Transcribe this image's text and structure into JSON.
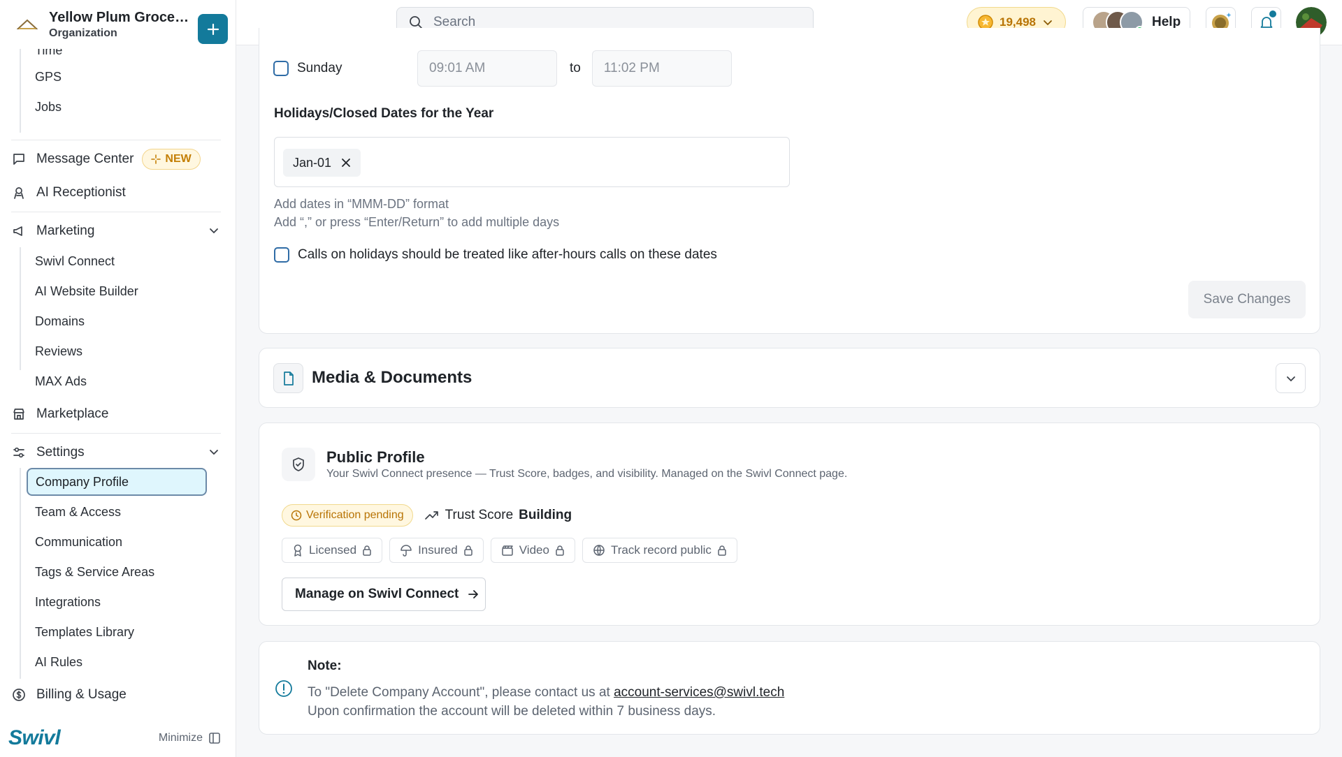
{
  "org": {
    "name": "Yellow Plum Grocers...",
    "subtitle": "Organization"
  },
  "search": {
    "placeholder": "Search"
  },
  "topbar": {
    "credits": "19,498",
    "help_label": "Help"
  },
  "sidebar": {
    "sub_top": [
      "Time",
      "GPS",
      "Jobs"
    ],
    "message_center": "Message Center",
    "new_badge": "NEW",
    "ai_receptionist": "AI Receptionist",
    "marketing": "Marketing",
    "marketing_items": [
      "Swivl Connect",
      "AI Website Builder",
      "Domains",
      "Reviews",
      "MAX Ads"
    ],
    "marketplace": "Marketplace",
    "settings": "Settings",
    "settings_items": [
      "Company Profile",
      "Team & Access",
      "Communication",
      "Tags & Service Areas",
      "Integrations",
      "Templates Library",
      "AI Rules"
    ],
    "billing": "Billing & Usage",
    "brand": "Swivl",
    "minimize": "Minimize"
  },
  "hours": {
    "day": "Sunday",
    "open_placeholder": "09:01 AM",
    "to": "to",
    "close_placeholder": "11:02 PM",
    "holidays_title": "Holidays/Closed Dates for the Year",
    "chip": "Jan-01",
    "hint1": "Add dates in “MMM-DD” format",
    "hint2": "Add “,” or press “Enter/Return” to add multiple days",
    "treat_label": "Calls on holidays should be treated like after-hours calls on these dates",
    "save": "Save Changes"
  },
  "media": {
    "title": "Media & Documents"
  },
  "public_profile": {
    "title": "Public Profile",
    "subtitle": "Your Swivl Connect presence — Trust Score, badges, and visibility. Managed on the Swivl Connect page.",
    "pending": "Verification pending",
    "trust_label": "Trust Score",
    "trust_value": "Building",
    "badges": [
      "Licensed",
      "Insured",
      "Video",
      "Track record public"
    ],
    "manage": "Manage on Swivl Connect"
  },
  "note": {
    "title": "Note:",
    "line1_prefix": "To \"Delete Company Account\", please contact us at ",
    "email": "account-services@swivl.tech",
    "line2": "Upon confirmation the account will be deleted within 7 business days."
  },
  "colors": {
    "accent": "#137a9b",
    "credits_bg": "#fff4d2",
    "pending_text": "#b87405",
    "active_nav_bg": "#dff6fd"
  }
}
